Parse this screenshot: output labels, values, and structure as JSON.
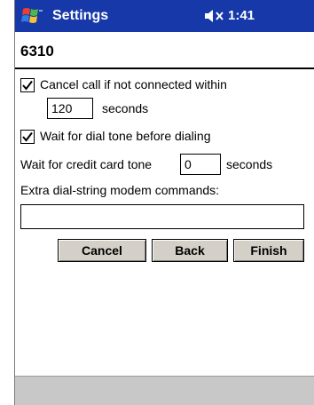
{
  "titlebar": {
    "app_title": "Settings",
    "clock": "1:41",
    "sound_icon": "speaker-muted-icon",
    "start_icon": "windows-flag-icon"
  },
  "page": {
    "heading": "6310"
  },
  "options": {
    "cancel_call": {
      "checked": true,
      "label": "Cancel call if not connected within",
      "value": "120",
      "unit": "seconds"
    },
    "wait_dial_tone": {
      "checked": true,
      "label": "Wait for dial tone before dialing"
    },
    "credit_card": {
      "label": "Wait for credit card tone",
      "value": "0",
      "unit": "seconds"
    },
    "extra_commands": {
      "label": "Extra dial-string modem commands:",
      "value": ""
    }
  },
  "buttons": {
    "cancel": "Cancel",
    "back": "Back",
    "finish": "Finish"
  },
  "colors": {
    "titlebar": "#1638a8",
    "button_face": "#d4d0c8",
    "bottom_bar": "#c8c8c8"
  }
}
